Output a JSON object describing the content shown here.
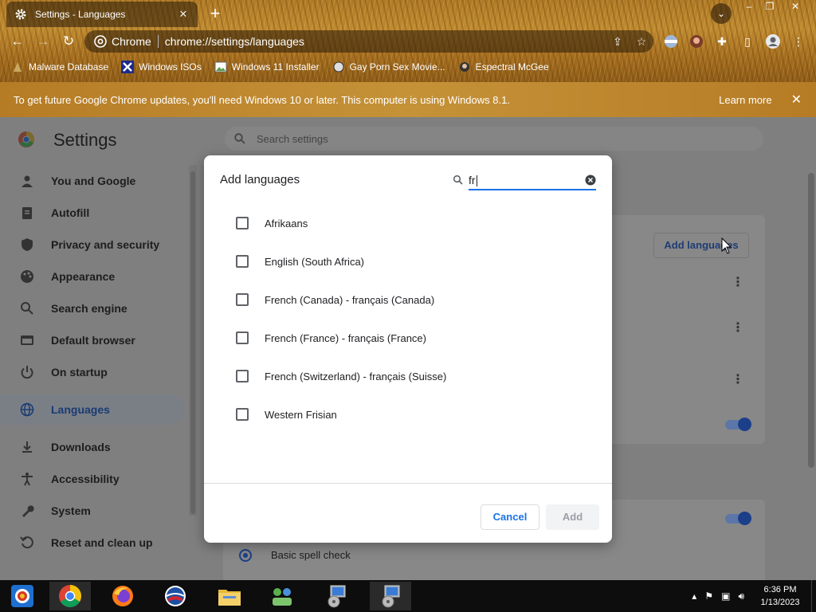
{
  "browser": {
    "tab_title": "Settings - Languages",
    "new_tab_icon": "plus-icon",
    "omnibox": {
      "site_label": "Chrome",
      "url": "chrome://settings/languages"
    },
    "bookmarks": [
      {
        "label": "Malware Database",
        "icon": "bookmark-favicon"
      },
      {
        "label": "Windows ISOs",
        "icon": "x-favicon"
      },
      {
        "label": "Windows 11 Installer",
        "icon": "image-favicon"
      },
      {
        "label": "Gay Porn Sex Movie...",
        "icon": "globe-favicon"
      },
      {
        "label": "Espectral McGee",
        "icon": "avatar-favicon"
      }
    ]
  },
  "infobar": {
    "message": "To get future Google Chrome updates, you'll need Windows 10 or later. This computer is using Windows 8.1.",
    "learn_more": "Learn more"
  },
  "settings": {
    "title": "Settings",
    "search_placeholder": "Search settings",
    "nav": [
      {
        "label": "You and Google",
        "icon": "person-icon"
      },
      {
        "label": "Autofill",
        "icon": "clipboard-icon"
      },
      {
        "label": "Privacy and security",
        "icon": "shield-icon"
      },
      {
        "label": "Appearance",
        "icon": "palette-icon"
      },
      {
        "label": "Search engine",
        "icon": "search-icon"
      },
      {
        "label": "Default browser",
        "icon": "browser-icon"
      },
      {
        "label": "On startup",
        "icon": "power-icon"
      },
      {
        "label": "Languages",
        "icon": "globe-icon",
        "active": true
      },
      {
        "label": "Downloads",
        "icon": "download-icon"
      },
      {
        "label": "Accessibility",
        "icon": "accessibility-icon"
      },
      {
        "label": "System",
        "icon": "wrench-icon"
      },
      {
        "label": "Reset and clean up",
        "icon": "reset-icon"
      }
    ],
    "add_languages_button": "Add languages",
    "spell_check_option": "Basic spell check"
  },
  "dialog": {
    "title": "Add languages",
    "search_value": "fr",
    "options": [
      {
        "label": "Afrikaans",
        "checked": false
      },
      {
        "label": "English (South Africa)",
        "checked": false
      },
      {
        "label": "French (Canada) - français (Canada)",
        "checked": false
      },
      {
        "label": "French (France) - français (France)",
        "checked": false
      },
      {
        "label": "French (Switzerland) - français (Suisse)",
        "checked": false
      },
      {
        "label": "Western Frisian",
        "checked": false
      }
    ],
    "cancel_label": "Cancel",
    "add_label": "Add"
  },
  "taskbar": {
    "apps": [
      "start-icon",
      "chrome-icon",
      "firefox-icon",
      "obama-logo-icon",
      "file-explorer-icon",
      "network-people-icon",
      "installer-icon",
      "installer-icon"
    ],
    "time": "6:36 PM",
    "date": "1/13/2023"
  },
  "colors": {
    "accent": "#1a73e8",
    "theme": "#c08a30"
  }
}
